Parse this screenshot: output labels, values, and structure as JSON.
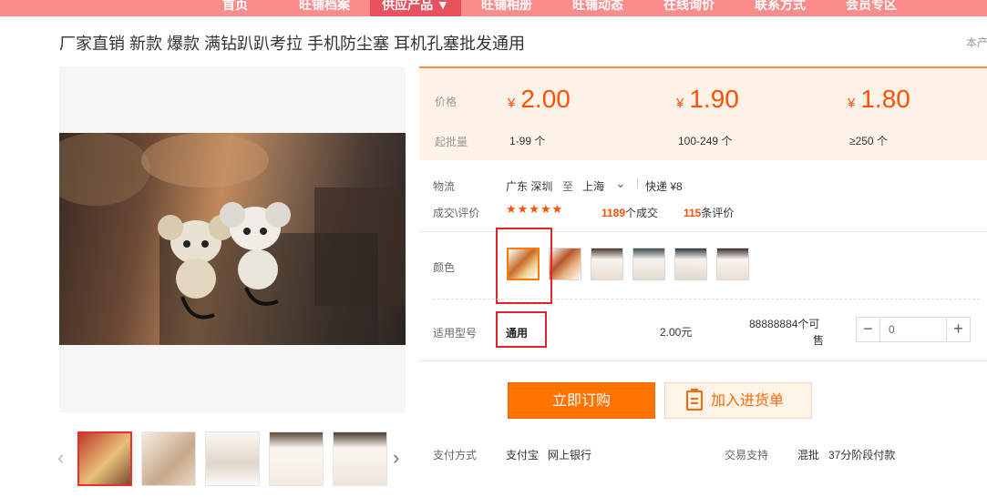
{
  "nav": {
    "items": [
      "首页",
      "旺铺档案",
      "供应产品 ▼",
      "旺铺相册",
      "旺铺动态",
      "在线询价",
      "联系方式",
      "会员专区"
    ],
    "active_index": 2
  },
  "product": {
    "title": "厂家直销 新款 爆款 满钻趴趴考拉 手机防尘塞 耳机孔塞批发通用",
    "right_hint": "本产"
  },
  "price": {
    "price_label": "价格",
    "moq_label": "起批量",
    "currency": "¥",
    "tiers": [
      {
        "price": "2.00",
        "qty": "1-99 个"
      },
      {
        "price": "1.90",
        "qty": "100-249 个"
      },
      {
        "price": "1.80",
        "qty": "≥250 个"
      }
    ]
  },
  "logistics": {
    "label": "物流",
    "from": "广东 深圳",
    "to_word": "至",
    "to": "上海",
    "shipping": "快递 ¥8"
  },
  "deals": {
    "label": "成交\\评价",
    "stars": "★★★★★",
    "deal_count": "1189",
    "deal_suffix": "个成交",
    "review_count": "115",
    "review_suffix": "条评价"
  },
  "color": {
    "label": "颜色",
    "swatches": 6,
    "selected_index": 0
  },
  "model": {
    "label": "适用型号",
    "value": "通用",
    "unit_price": "2.00元",
    "stock_line1": "88888884个可",
    "stock_line2": "售",
    "quantity": "0",
    "minus": "−",
    "plus": "+"
  },
  "actions": {
    "order_label": "立即订购",
    "cart_label": "加入进货单"
  },
  "payment": {
    "label": "支付方式",
    "methods": "支付宝   网上银行",
    "trade_label": "交易支持",
    "trade_value": "混批   37分阶段付款"
  },
  "thumbnails": {
    "prev": "‹",
    "next": "›",
    "count": 5,
    "active_index": 0
  },
  "colors": {
    "accent": "#ff5000",
    "nav_bg": "#fa8c8c",
    "nav_active": "#e8525e",
    "price_bg": "#fff2e8",
    "highlight_box": "#e3222a"
  }
}
